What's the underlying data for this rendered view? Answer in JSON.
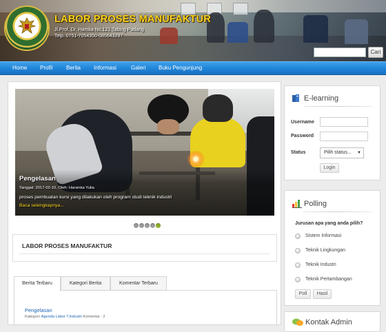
{
  "header": {
    "title": "LABOR PROSES MANUFAKTUR",
    "address": "Jl.Prof. Dr. Hamka No.121 Tabing Padang",
    "phone": "Telp. 0751-7054350-085643297",
    "search_placeholder": "",
    "search_button": "Cari"
  },
  "nav": {
    "items": [
      "Home",
      "Profil",
      "Berita",
      "Informasi",
      "Galeri",
      "Buku Pengunjung"
    ]
  },
  "slideshow": {
    "title": "Pengelasan",
    "meta": "Tanggal: 2017-02-10, Oleh: Harsinka Yulia",
    "description": "proses pembuatan kursi yang dilakukan oleh program studi teknik industri",
    "read_more": "Baca selengkapnya...",
    "slide_count": 5,
    "active_slide": 5
  },
  "section": {
    "title": "LABOR PROSES MANUFAKTUR"
  },
  "tabs": {
    "items": [
      "Berita Terbaru",
      "Kategori Berita",
      "Komentar Terbaru"
    ],
    "active": 0
  },
  "latest_post": {
    "title": "Pengelasan",
    "meta_prefix": "Kategori:",
    "category": "Agenda Labor T.Industri",
    "comments": "Komentar : 2"
  },
  "elearning": {
    "title": "E-learning",
    "username_label": "Username",
    "password_label": "Password",
    "status_label": "Status",
    "status_value": "Pilih status...",
    "login_button": "Login"
  },
  "polling": {
    "title": "Polling",
    "question": "Jurusan apa yang anda pilih?",
    "options": [
      "Sistem Informasi",
      "Teknik Lingkungan",
      "Teknik Industri",
      "Teknik Pertambangan"
    ],
    "poll_button": "Poll",
    "result_button": "Hasil"
  },
  "contact": {
    "title": "Kontak Admin"
  },
  "colors": {
    "nav_blue": "#1f84d8",
    "title_yellow": "#ffd21a",
    "link_blue": "#1c63b7",
    "active_dot": "#8fae2c"
  }
}
